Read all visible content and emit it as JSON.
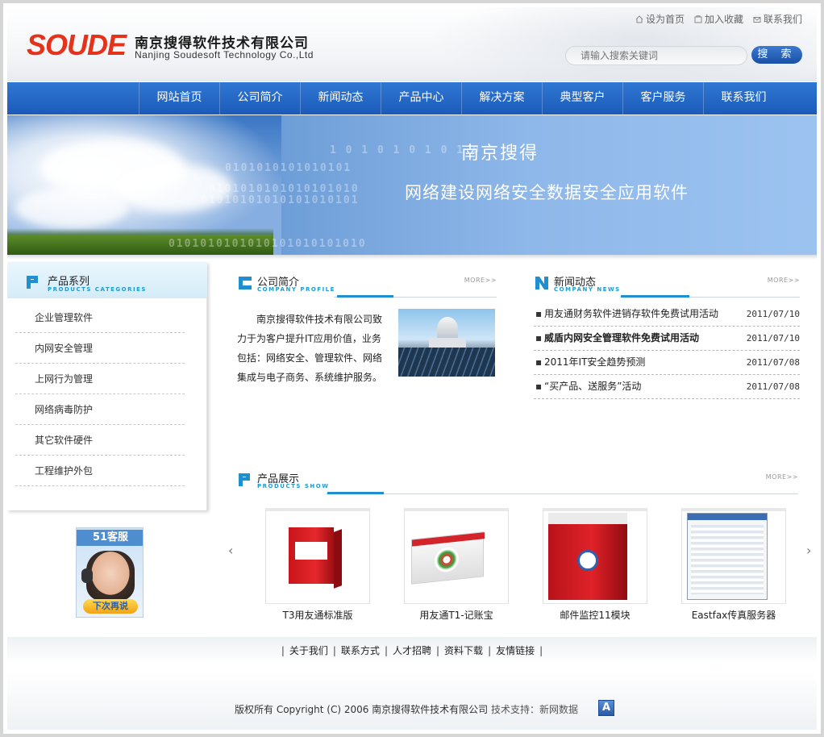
{
  "header": {
    "logo_text": "SOUDE",
    "company_cn": "南京搜得软件技术有限公司",
    "company_en": "Nanjing Soudesoft Technology Co.,Ltd",
    "top_links": [
      {
        "label": "设为首页",
        "icon": "home-icon"
      },
      {
        "label": "加入收藏",
        "icon": "bookmark-icon"
      },
      {
        "label": "联系我们",
        "icon": "mail-icon"
      }
    ],
    "search": {
      "placeholder": "请输入搜索关键词",
      "button": "搜 索"
    }
  },
  "nav": {
    "items": [
      "网站首页",
      "公司简介",
      "新闻动态",
      "产品中心",
      "解决方案",
      "典型客户",
      "客户服务",
      "联系我们"
    ]
  },
  "banner": {
    "title": "南京搜得",
    "subtitle": "网络建设网络安全数据安全应用软件",
    "binary_rows": [
      "1 0 1 0 1 0 1 0 1 0",
      "0101010101010101",
      "0101010101010101010",
      "01010101010101010101",
      "0101010101010101010101010"
    ]
  },
  "sidebar": {
    "title_cn": "产品系列",
    "title_en": "PRODUCTS CATEGORIES",
    "items": [
      "企业管理软件",
      "内网安全管理",
      "上网行为管理",
      "网络病毒防护",
      "其它软件硬件",
      "工程维护外包"
    ],
    "service_label": "51客服",
    "service_status": "下次再说"
  },
  "intro": {
    "title_cn": "公司简介",
    "title_en": "COMPANY PROFILE",
    "more": "MORE>>",
    "text": "南京搜得软件技术有限公司致力于为客户提升IT应用价值，业务包括：网络安全、管理软件、网络集成与电子商务、系统维护服务。"
  },
  "news": {
    "title_cn": "新闻动态",
    "title_en": "COMPANY NEWS",
    "more": "MORE>>",
    "items": [
      {
        "title": "用友通财务软件进销存软件免费试用活动",
        "date": "2011/07/10",
        "bold": false
      },
      {
        "title": "威盾内网安全管理软件免费试用活动",
        "date": "2011/07/10",
        "bold": true
      },
      {
        "title": "2011年IT安全趋势预测",
        "date": "2011/07/08",
        "bold": false
      },
      {
        "title": "“买产品、送服务”活动",
        "date": "2011/07/08",
        "bold": false
      }
    ]
  },
  "products": {
    "title_cn": "产品展示",
    "title_en": "PRODUCTS SHOW",
    "more": "MORE>>",
    "items": [
      "T3用友通标准版",
      "用友通T1-记账宝",
      "邮件监控11模块",
      "Eastfax传真服务器"
    ]
  },
  "footer": {
    "links": [
      "关于我们",
      "联系方式",
      "人才招聘",
      "资料下载",
      "友情链接"
    ],
    "copyright": "版权所有 Copyright (C) 2006 南京搜得软件技术有限公司",
    "support": "技术支持：新网数据",
    "badge": "A"
  },
  "colors": {
    "nav_blue": "#1c5ab8",
    "logo_red": "#e5331b",
    "accent_cyan": "#1f8fcf"
  }
}
